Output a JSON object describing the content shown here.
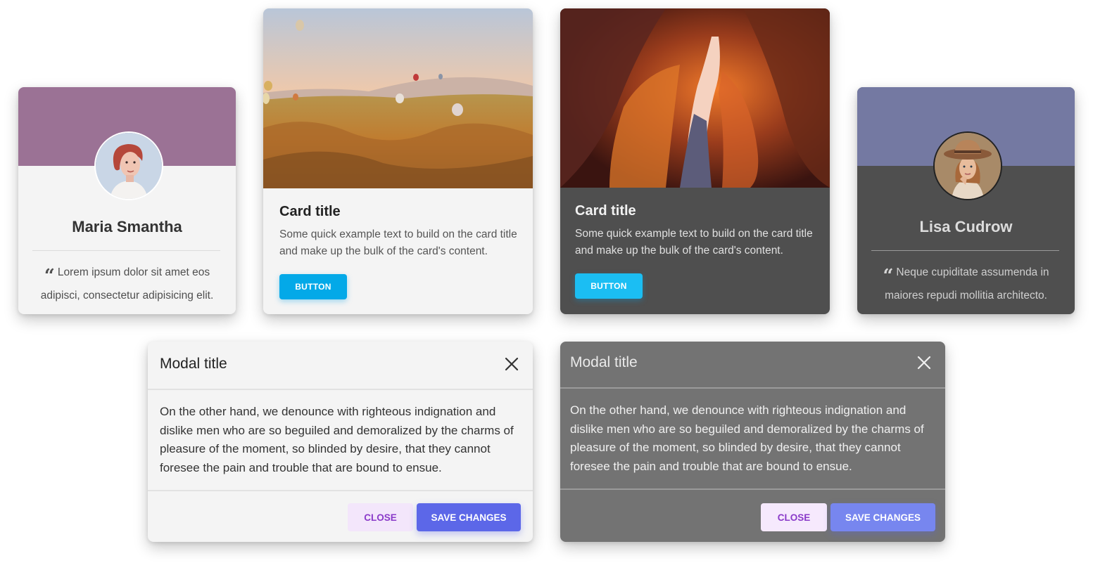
{
  "testimonials": [
    {
      "theme": "light",
      "name": "Maria Smantha",
      "quote_icon": "quote-left-icon",
      "quote": "Lorem ipsum dolor sit amet eos adipisci, consectetur adipisicing elit.",
      "header_color": "#9b7295"
    },
    {
      "theme": "dark",
      "name": "Lisa Cudrow",
      "quote_icon": "quote-left-icon",
      "quote": "Neque cupiditate assumenda in maiores repudi mollitia architecto.",
      "header_color": "#7479a2"
    }
  ],
  "image_cards": [
    {
      "theme": "light",
      "image": "hot-air-balloons-landscape",
      "title": "Card title",
      "text": "Some quick example text to build on the card title and make up the bulk of the card's content.",
      "button_label": "BUTTON",
      "button_color": "#03a9e8"
    },
    {
      "theme": "dark",
      "image": "slot-canyon",
      "title": "Card title",
      "text": "Some quick example text to build on the card title and make up the bulk of the card's content.",
      "button_label": "BUTTON",
      "button_color": "#1bbef3"
    }
  ],
  "modals": [
    {
      "theme": "light",
      "title": "Modal title",
      "close_icon": "close-icon",
      "body": "On the other hand, we denounce with righteous indignation and dislike men who are so beguiled and demoralized by the charms of pleasure of the moment, so blinded by desire, that they cannot foresee the pain and trouble that are bound to ensue.",
      "close_label": "CLOSE",
      "save_label": "SAVE CHANGES",
      "save_color": "#5c67e8"
    },
    {
      "theme": "dark",
      "title": "Modal title",
      "close_icon": "close-icon",
      "body": "On the other hand, we denounce with righteous indignation and dislike men who are so beguiled and demoralized by the charms of pleasure of the moment, so blinded by desire, that they cannot foresee the pain and trouble that are bound to ensue.",
      "close_label": "CLOSE",
      "save_label": "SAVE CHANGES",
      "save_color": "#7786ef"
    }
  ]
}
